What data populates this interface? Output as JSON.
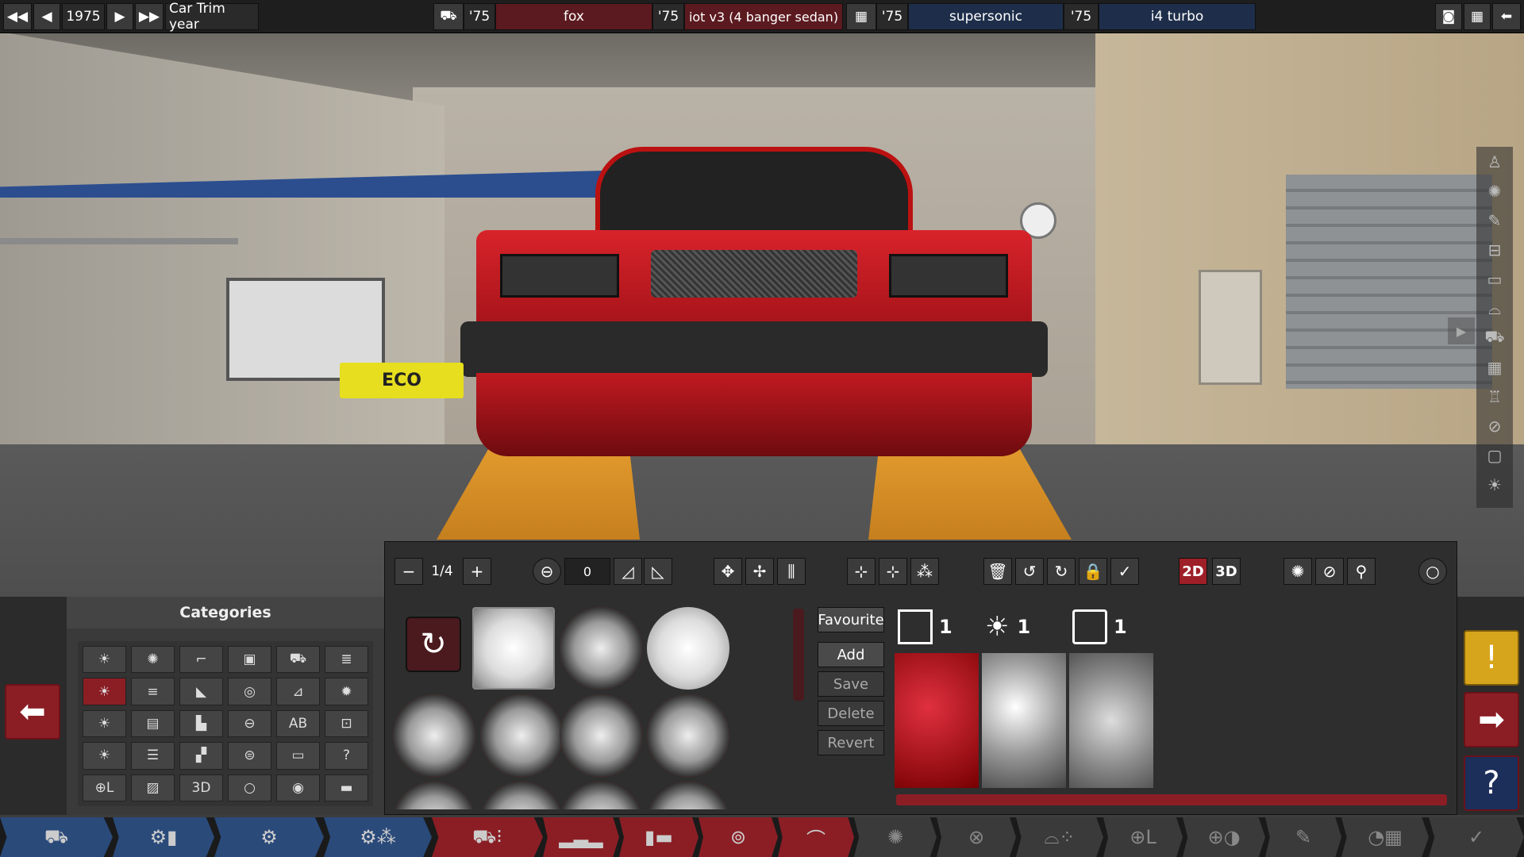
{
  "topbar": {
    "year": "1975",
    "trim_label": "Car Trim year",
    "model_year": "'75",
    "model_name": "fox",
    "body_year": "'75",
    "body_name": "iot v3 (4 banger sedan)",
    "engine_year": "'75",
    "engine_name": "supersonic",
    "variant_year": "'75",
    "variant_name": "i4 turbo"
  },
  "car": {
    "plate": "ECO"
  },
  "categories": {
    "title": "Categories",
    "items": [
      "☀",
      "✺",
      "⌐",
      "▣",
      "⛟",
      "≣",
      "☀",
      "≡",
      "◣",
      "◎",
      "⊿",
      "✹",
      "☀",
      "▤",
      "▙",
      "⊖",
      "AB",
      "⊡",
      "☀",
      "☰",
      "▞",
      "⊜",
      "▭",
      "?",
      "⊕L",
      "▨",
      "3D",
      "○",
      "◉",
      "▬"
    ]
  },
  "editor": {
    "page": "1/4",
    "rotation_value": "0",
    "mode_2d": "2D",
    "mode_3d": "3D",
    "favourite": "Favourite",
    "add": "Add",
    "save": "Save",
    "delete": "Delete",
    "revert": "Revert",
    "mat1_count": "1",
    "mat2_count": "1",
    "mat3_count": "1"
  },
  "colors": {
    "accent": "#8b1e25",
    "blue": "#2a4a7a",
    "panel": "#2e2e2e"
  }
}
